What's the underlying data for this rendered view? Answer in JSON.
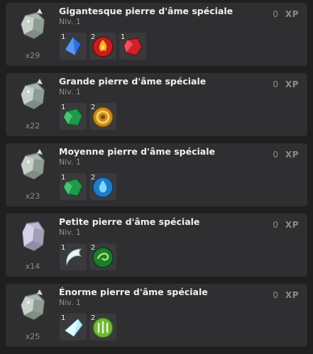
{
  "items": [
    {
      "title": "Gigantesque pierre d'âme spéciale",
      "level": "Niv. 1",
      "quantity": "x29",
      "xp_value": "0",
      "xp_label": "XP",
      "stone_icon": "gray-soul-stone-icon",
      "resources": [
        {
          "count": "1",
          "icon": "blue-crystal-icon"
        },
        {
          "count": "2",
          "icon": "red-fire-orb-icon"
        },
        {
          "count": "1",
          "icon": "red-gem-icon"
        }
      ]
    },
    {
      "title": "Grande pierre d'âme spéciale",
      "level": "Niv. 1",
      "quantity": "x22",
      "xp_value": "0",
      "xp_label": "XP",
      "stone_icon": "gray-soul-stone-icon",
      "resources": [
        {
          "count": "1",
          "icon": "green-emerald-icon"
        },
        {
          "count": "2",
          "icon": "golden-ring-orb-icon"
        }
      ]
    },
    {
      "title": "Moyenne pierre d'âme spéciale",
      "level": "Niv. 1",
      "quantity": "x23",
      "xp_value": "0",
      "xp_label": "XP",
      "stone_icon": "gray-soul-stone-icon",
      "resources": [
        {
          "count": "1",
          "icon": "green-emerald-icon"
        },
        {
          "count": "2",
          "icon": "blue-water-orb-icon"
        }
      ]
    },
    {
      "title": "Petite pierre d'âme spéciale",
      "level": "Niv. 1",
      "quantity": "x14",
      "xp_value": "0",
      "xp_label": "XP",
      "stone_icon": "lavender-soul-stone-icon",
      "resources": [
        {
          "count": "1",
          "icon": "white-fang-icon"
        },
        {
          "count": "2",
          "icon": "green-swirl-orb-icon"
        }
      ]
    },
    {
      "title": "Énorme pierre d'âme spéciale",
      "level": "Niv. 1",
      "quantity": "x25",
      "xp_value": "0",
      "xp_label": "XP",
      "stone_icon": "gray-soul-stone-icon",
      "resources": [
        {
          "count": "1",
          "icon": "ice-crystal-icon"
        },
        {
          "count": "2",
          "icon": "green-leaf-orb-icon"
        }
      ]
    }
  ],
  "colors": {
    "background": "#1f1f1f",
    "card": "#2f2f31",
    "slot": "#3a3a3c",
    "title": "#f0f0f0",
    "muted": "#8f8f8f"
  }
}
